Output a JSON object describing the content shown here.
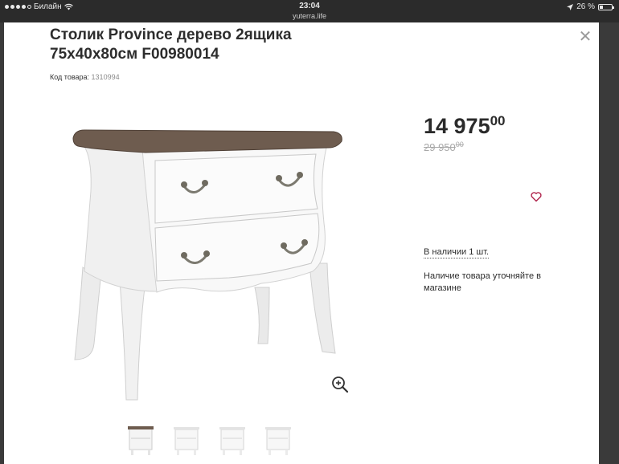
{
  "status_bar": {
    "carrier": "Билайн",
    "time": "23:04",
    "url": "yuterra.life",
    "battery": "26 %",
    "battery_level": 0.26
  },
  "product": {
    "title": "Столик Province дерево 2ящика 75х40х80см F00980014",
    "code_label": "Код товара:",
    "code_value": "1310994",
    "price_main": "14 975",
    "price_cents": "00",
    "old_price_main": "29 950",
    "old_price_cents": "00",
    "stock_text": "В наличии 1 шт.",
    "note_text": "Наличие товара уточняйте в магазине"
  },
  "colors": {
    "accent_heart": "#b0244c",
    "title": "#2d2d2d",
    "old_price": "#a8a8a8"
  },
  "icons": {
    "close": "close-icon",
    "zoom": "zoom-in-icon",
    "favorite": "heart-icon",
    "wifi": "wifi-icon",
    "location": "location-arrow-icon"
  }
}
